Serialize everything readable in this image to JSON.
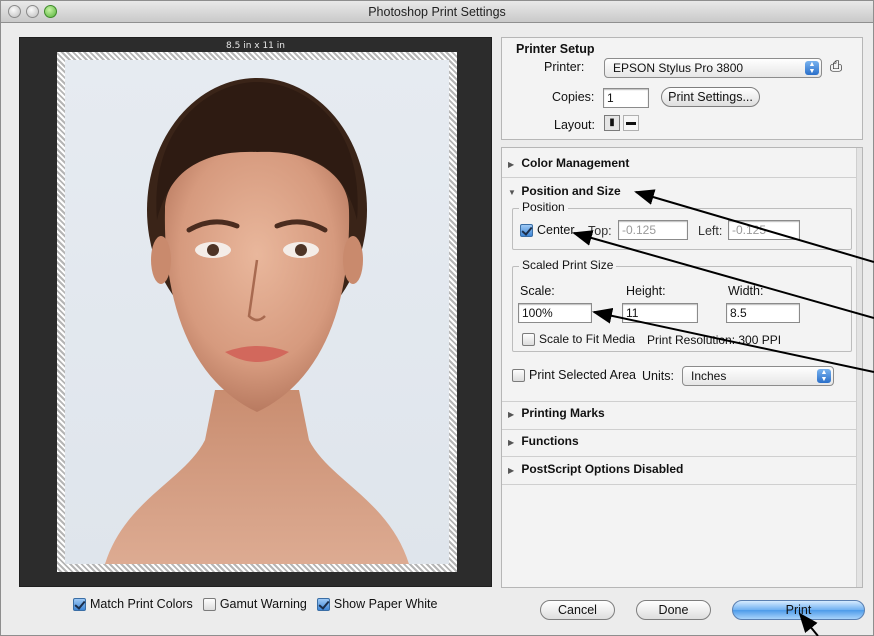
{
  "window": {
    "title": "Photoshop Print Settings"
  },
  "preview": {
    "paper_size": "8.5 in x 11 in"
  },
  "bottom": {
    "match_print_colors": {
      "label": "Match Print Colors",
      "checked": true
    },
    "gamut_warning": {
      "label": "Gamut Warning",
      "checked": false
    },
    "show_paper_white": {
      "label": "Show Paper White",
      "checked": true
    }
  },
  "printer_setup": {
    "heading": "Printer Setup",
    "printer_label": "Printer:",
    "printer_value": "EPSON Stylus Pro 3800",
    "copies_label": "Copies:",
    "copies_value": "1",
    "print_settings_button": "Print Settings...",
    "layout_label": "Layout:"
  },
  "sections": {
    "color_management": "Color Management",
    "position_and_size": "Position and Size",
    "printing_marks": "Printing Marks",
    "functions": "Functions",
    "postscript": "PostScript Options Disabled"
  },
  "position": {
    "group_title": "Position",
    "center_label": "Center",
    "center_checked": true,
    "top_label": "Top:",
    "top_value": "-0.125",
    "left_label": "Left:",
    "left_value": "-0.125"
  },
  "scaled": {
    "group_title": "Scaled Print Size",
    "scale_label": "Scale:",
    "height_label": "Height:",
    "width_label": "Width:",
    "scale_value": "100%",
    "height_value": "11",
    "width_value": "8.5",
    "fit_media_label": "Scale to Fit Media",
    "fit_media_checked": false,
    "resolution_text": "Print Resolution: 300 PPI"
  },
  "selected_area": {
    "label": "Print Selected Area",
    "checked": false,
    "units_label": "Units:",
    "units_value": "Inches"
  },
  "buttons": {
    "cancel": "Cancel",
    "done": "Done",
    "print": "Print"
  },
  "colors": {
    "accent": "#4d9be9",
    "preview_bg": "#2c2c2c",
    "window_bg": "#ececec"
  }
}
